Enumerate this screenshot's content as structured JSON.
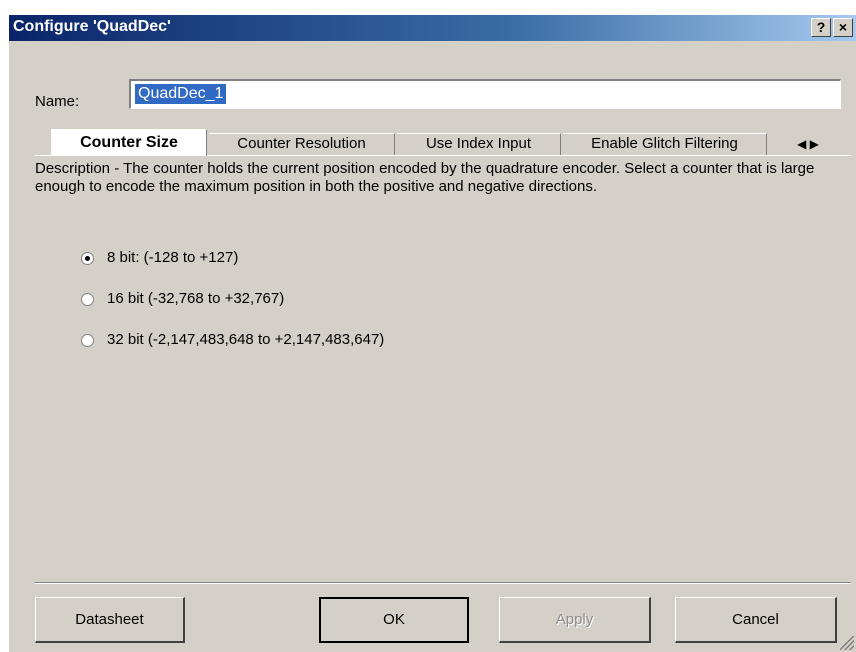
{
  "window": {
    "title": "Configure 'QuadDec'",
    "help_button": "?",
    "close_button": "×"
  },
  "name_field": {
    "label": "Name:",
    "value": "QuadDec_1"
  },
  "tabs": [
    {
      "label": "Counter Size",
      "active": true
    },
    {
      "label": "Counter Resolution",
      "active": false
    },
    {
      "label": "Use Index Input",
      "active": false
    },
    {
      "label": "Enable Glitch Filtering",
      "active": false
    }
  ],
  "tab_scroll": {
    "left": "◀",
    "right": "▶"
  },
  "description": "Description - The counter holds the current position encoded by the quadrature encoder. Select a counter that is large enough to encode the maximum position in both the positive and negative directions.",
  "options": [
    {
      "label": "8 bit: (-128 to +127)",
      "checked": true
    },
    {
      "label": "16 bit (-32,768 to +32,767)",
      "checked": false
    },
    {
      "label": "32 bit (-2,147,483,648 to +2,147,483,647)",
      "checked": false
    }
  ],
  "buttons": {
    "datasheet": "Datasheet",
    "ok": "OK",
    "apply": "Apply",
    "cancel": "Cancel"
  },
  "colors": {
    "face": "#d4d0c8",
    "titlebar_start": "#0a246a",
    "titlebar_end": "#a6caf0",
    "selection": "#316ac5"
  }
}
